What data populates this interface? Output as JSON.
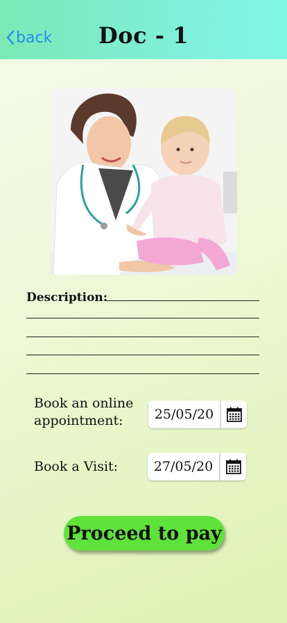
{
  "header": {
    "back_label": "back",
    "title": "Doc - 1"
  },
  "photo": {
    "icon": "doctor-with-baby-photo"
  },
  "description": {
    "label": "Description:"
  },
  "online_appointment": {
    "label_line1": "Book an online",
    "label_line2": "appointment:",
    "date": "25/05/20",
    "icon": "calendar-icon"
  },
  "visit": {
    "label": "Book a Visit:",
    "date": "27/05/20",
    "icon": "calendar-icon"
  },
  "pay_button": {
    "label": "Proceed to pay"
  },
  "colors": {
    "header_gradient_start": "#7be8b5",
    "header_gradient_end": "#80f4e6",
    "back_link": "#1f8ff0",
    "pay_button": "#5fe23a",
    "background_top": "#f7fbe9",
    "background_bottom": "#def3b4"
  }
}
